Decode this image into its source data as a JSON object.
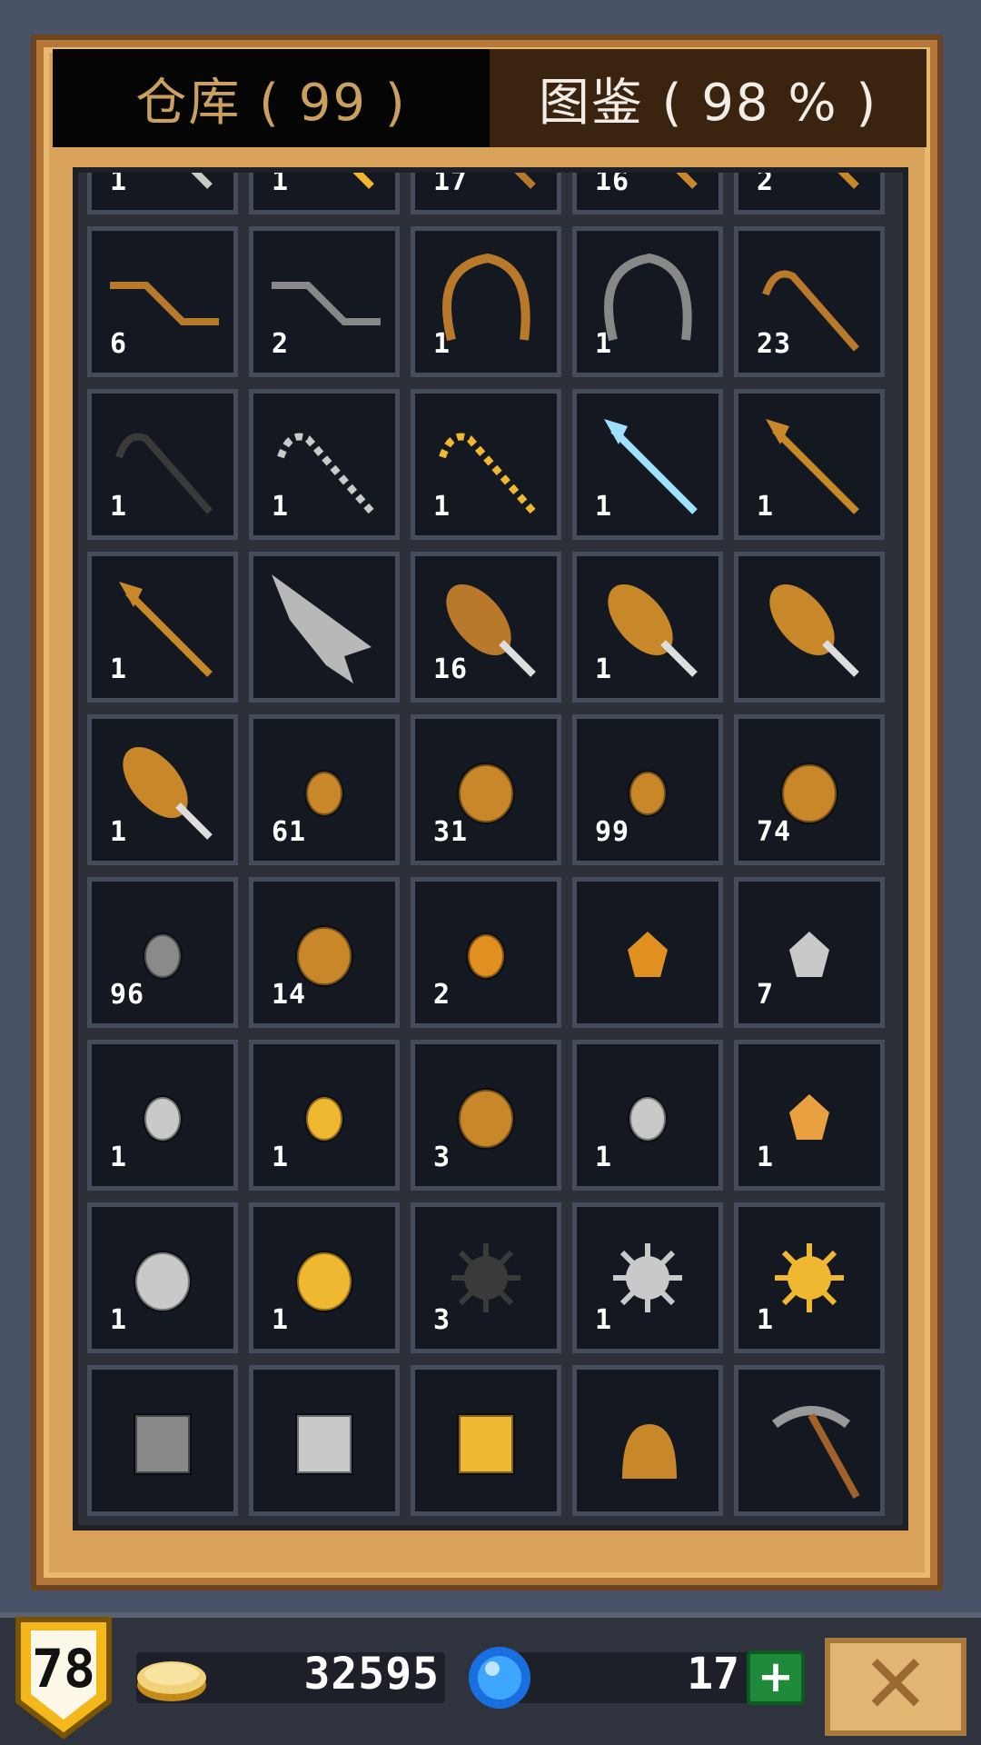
{
  "tabs": {
    "storage": "仓库 ( 99 )",
    "collection": "图鉴 ( 98 % )"
  },
  "items": [
    {
      "icon": "silver-spear-icon",
      "count": "1"
    },
    {
      "icon": "gold-spear-icon",
      "count": "1"
    },
    {
      "icon": "wooden-spear-icon",
      "count": "17"
    },
    {
      "icon": "bronze-spear-icon",
      "count": "16"
    },
    {
      "icon": "pickaxe-spear-icon",
      "count": "2"
    },
    {
      "icon": "wooden-stairs-icon",
      "count": "6"
    },
    {
      "icon": "iron-stairs-icon",
      "count": "2"
    },
    {
      "icon": "wooden-bow-icon",
      "count": "1"
    },
    {
      "icon": "iron-bow-icon",
      "count": "1"
    },
    {
      "icon": "wooden-cane-icon",
      "count": "23"
    },
    {
      "icon": "dark-cane-icon",
      "count": "1"
    },
    {
      "icon": "silver-cane-icon",
      "count": "1"
    },
    {
      "icon": "gold-cane-icon",
      "count": "1"
    },
    {
      "icon": "ice-staff-icon",
      "count": "1"
    },
    {
      "icon": "crown-staff-icon",
      "count": "1"
    },
    {
      "icon": "bird-staff-icon",
      "count": "1"
    },
    {
      "icon": "stone-arrowhead-icon",
      "count": ""
    },
    {
      "icon": "wooden-club-icon",
      "count": "16"
    },
    {
      "icon": "fanged-club-icon",
      "count": "1"
    },
    {
      "icon": "large-club-icon",
      "count": ""
    },
    {
      "icon": "spiked-club-icon",
      "count": "1"
    },
    {
      "icon": "bronze-coin-icon",
      "count": "61"
    },
    {
      "icon": "large-bronze-coin-icon",
      "count": "31"
    },
    {
      "icon": "bronze-nugget-icon",
      "count": "99"
    },
    {
      "icon": "bronze-shield-coin-icon",
      "count": "74"
    },
    {
      "icon": "stone-coin-icon",
      "count": "96"
    },
    {
      "icon": "large-stone-coin-icon",
      "count": "14"
    },
    {
      "icon": "orange-coin-icon",
      "count": "2"
    },
    {
      "icon": "orange-gem-icon",
      "count": ""
    },
    {
      "icon": "silver-gem-icon",
      "count": "7"
    },
    {
      "icon": "silver-coin-icon",
      "count": "1"
    },
    {
      "icon": "gold-coin-icon",
      "count": "1"
    },
    {
      "icon": "large-silver-coin-icon",
      "count": "3"
    },
    {
      "icon": "silver-oval-coin-icon",
      "count": "1"
    },
    {
      "icon": "amber-gem-icon",
      "count": "1"
    },
    {
      "icon": "silver-medal-icon",
      "count": "1"
    },
    {
      "icon": "gold-medal-icon",
      "count": "1"
    },
    {
      "icon": "dark-spiked-ball-icon",
      "count": "3"
    },
    {
      "icon": "silver-spiked-ball-icon",
      "count": "1"
    },
    {
      "icon": "gold-spiked-ball-icon",
      "count": "1"
    },
    {
      "icon": "iron-armor-icon",
      "count": ""
    },
    {
      "icon": "silver-armor-icon",
      "count": ""
    },
    {
      "icon": "gold-armor-icon",
      "count": ""
    },
    {
      "icon": "bronze-helmet-icon",
      "count": ""
    },
    {
      "icon": "pickaxe-icon",
      "count": ""
    }
  ],
  "footer": {
    "level": "78",
    "gold": "32595",
    "gems": "17",
    "plus_label": "+",
    "close_label": "✕"
  },
  "colors": {
    "frame": "#d9a25a",
    "panel": "#2d3038",
    "cell": "#141821",
    "tab_text": "#c9a05e"
  }
}
